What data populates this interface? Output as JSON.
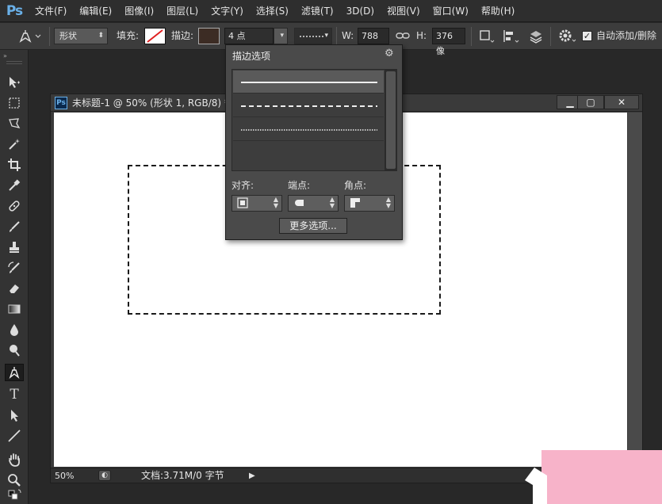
{
  "app": {
    "logo": "Ps"
  },
  "menu": [
    "文件(F)",
    "编辑(E)",
    "图像(I)",
    "图层(L)",
    "文字(Y)",
    "选择(S)",
    "滤镜(T)",
    "3D(D)",
    "视图(V)",
    "窗口(W)",
    "帮助(H)"
  ],
  "options_bar": {
    "mode": "形状",
    "fill_label": "填充:",
    "stroke_label": "描边:",
    "stroke_width": "4 点",
    "w_label": "W:",
    "w_value": "788 像",
    "h_label": "H:",
    "h_value": "376 像",
    "auto_add_label": "自动添加/删除",
    "auto_add_checked": true
  },
  "stroke_popup": {
    "title": "描边选项",
    "styles": [
      "solid",
      "dashed",
      "dotted"
    ],
    "align_label": "对齐:",
    "caps_label": "端点:",
    "corners_label": "角点:",
    "more_button": "更多选项..."
  },
  "document": {
    "title": "未标题-1 @ 50% (形状 1, RGB/8) *",
    "zoom": "50%",
    "info": "文档:3.71M/0 字节"
  },
  "colors": {
    "accent": "#6ab0e8",
    "canvas": "#ffffff",
    "panel": "#4a4a4a",
    "corner_overlay": "#f7b3c9"
  }
}
